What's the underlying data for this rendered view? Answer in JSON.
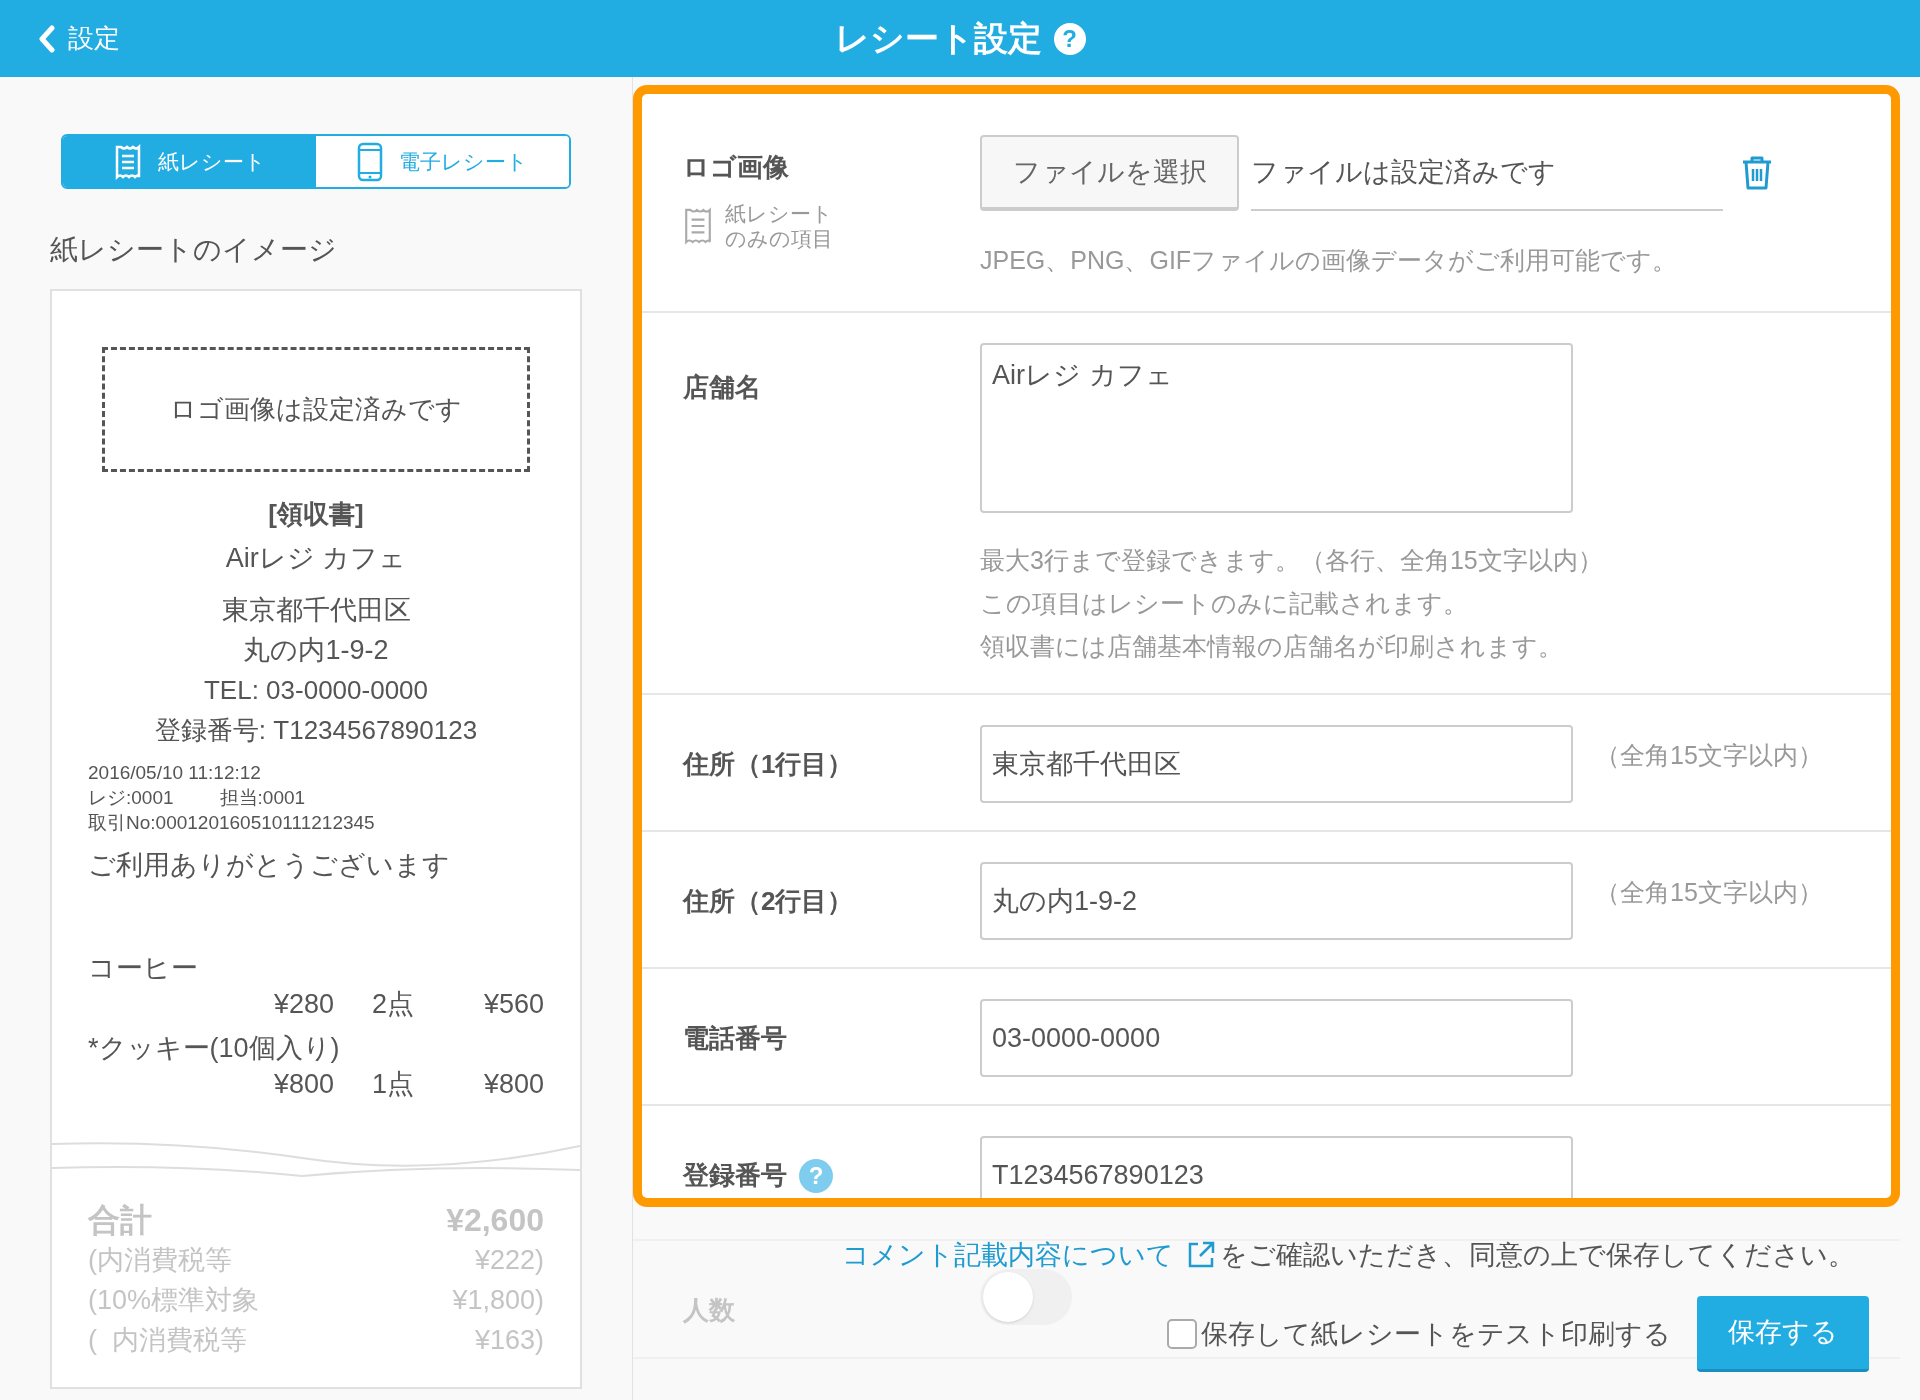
{
  "header": {
    "back_label": "設定",
    "title": "レシート設定",
    "help": "?"
  },
  "tabs": [
    {
      "label": "紙レシート",
      "kind": "paper",
      "selected": true
    },
    {
      "label": "電子レシート",
      "kind": "phone",
      "selected": false
    }
  ],
  "preview_title": "紙レシートのイメージ",
  "receipt": {
    "logo_placeholder": "ロゴ画像は設定済みです",
    "heading": "[領収書]",
    "store": "Airレジ カフェ",
    "address": [
      "東京都千代田区",
      "丸の内1-9-2"
    ],
    "tel": "TEL: 03-0000-0000",
    "registration": "登録番号: T1234567890123",
    "meta": [
      "2016/05/10 11:12:12",
      "レジ:0001",
      "担当:0001",
      "取引No:000120160510111212345"
    ],
    "thanks": "ご利用ありがとうございます",
    "items": [
      {
        "name": "コーヒー",
        "unit": "¥280",
        "qty": "2点",
        "total": "¥560"
      },
      {
        "name": "*クッキー(10個入り)",
        "unit": "¥800",
        "qty": "1点",
        "total": "¥800"
      }
    ],
    "totals": [
      {
        "label": "合計",
        "value": "¥2,600",
        "bold": true
      },
      {
        "label": "(内消費税等",
        "value": "¥222)",
        "bold": false
      },
      {
        "label": "(10%標準対象",
        "value": "¥1,800)",
        "bold": false
      },
      {
        "label": "(  内消費税等",
        "value": "¥163)",
        "bold": false
      }
    ]
  },
  "form": [
    {
      "kind": "file",
      "label": "ロゴ画像",
      "paper_only": [
        "紙レシート",
        "のみの項目"
      ],
      "button": "ファイルを選択",
      "value": "ファイルは設定済みです",
      "hints": [
        "JPEG、PNG、GIFファイルの画像データがご利用可能です。"
      ]
    },
    {
      "kind": "textarea",
      "label": "店舗名",
      "value": "Airレジ カフェ",
      "hints": [
        "最大3行まで登録できます。（各行、全角15文字以内）",
        "この項目はレシートのみに記載されます。",
        "領収書には店舗基本情報の店舗名が印刷されます。"
      ]
    },
    {
      "kind": "text",
      "label": "住所（1行目）",
      "value": "東京都千代田区",
      "side_note": "（全角15文字以内）"
    },
    {
      "kind": "text",
      "label": "住所（2行目）",
      "value": "丸の内1-9-2",
      "side_note": "（全角15文字以内）"
    },
    {
      "kind": "text",
      "label": "電話番号",
      "value": "03-0000-0000"
    },
    {
      "kind": "text",
      "label": "登録番号",
      "help": "?",
      "value": "T1234567890123"
    }
  ],
  "hidden_row": {
    "label": "人数",
    "on": false
  },
  "footer": {
    "link": "コメント記載内容について",
    "consent": "をご確認いただき、同意の上で保存してください。",
    "test_print": {
      "label": "保存して紙レシートをテスト印刷する",
      "checked": false
    },
    "save": "保存する"
  }
}
